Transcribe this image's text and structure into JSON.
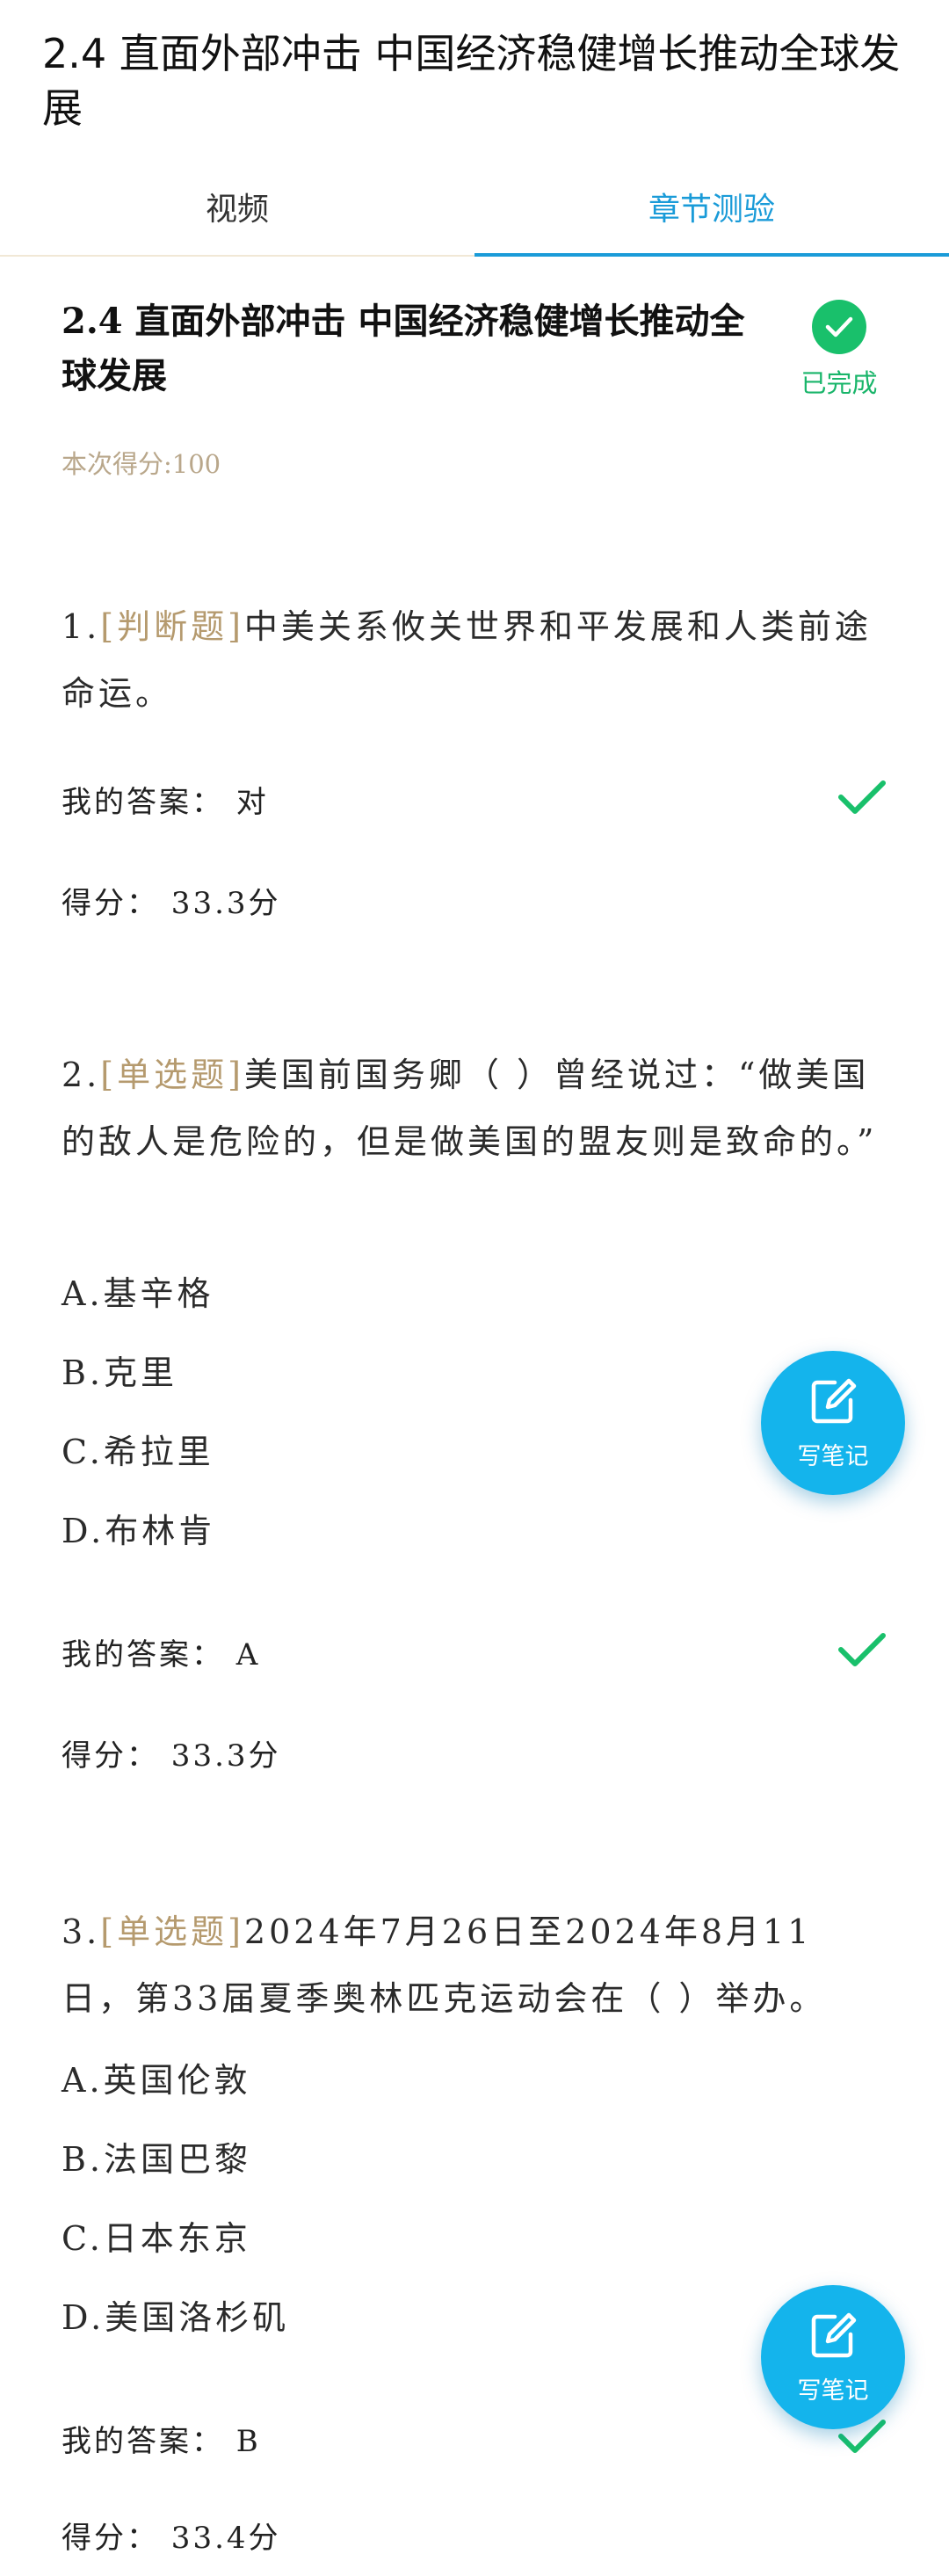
{
  "page": {
    "title": "2.4 直面外部冲击 中国经济稳健增长推动全球发展"
  },
  "tabs": [
    {
      "label": "视频",
      "active": false
    },
    {
      "label": "章节测验",
      "active": true
    }
  ],
  "section": {
    "title": "2.4 直面外部冲击 中国经济稳健增长推动全球发展",
    "status": "已完成",
    "score_text": "本次得分:100"
  },
  "questions": [
    {
      "number": "1.",
      "type": "[判断题]",
      "text": "中美关系攸关世界和平发展和人类前途命运。",
      "options": [],
      "my_answer": "我的答案：  对",
      "score": "得分：  33.3分",
      "correct": true
    },
    {
      "number": "2.",
      "type": "[单选题]",
      "text": "美国前国务卿（ ）曾经说过：“做美国的敌人是危险的，但是做美国的盟友则是致命的。”",
      "options": [
        "A.基辛格",
        "B.克里",
        "C.希拉里",
        "D.布林肯"
      ],
      "my_answer": "我的答案：  A",
      "score": "得分：  33.3分",
      "correct": true
    },
    {
      "number": "3.",
      "type": "[单选题]",
      "text": "2024年7月26日至2024年8月11日，第33届夏季奥林匹克运动会在（ ）举办。",
      "options": [
        "A.英国伦敦",
        "B.法国巴黎",
        "C.日本东京",
        "D.美国洛杉矶"
      ],
      "my_answer": "我的答案：  B",
      "score": "得分：  33.4分",
      "correct": true
    }
  ],
  "note_button": {
    "label": "写笔记",
    "icon": "edit-note-icon"
  },
  "colors": {
    "accent": "#1a9bd8",
    "success": "#19c06b",
    "tag": "#b59a6e",
    "float_button": "#14b4ec"
  }
}
